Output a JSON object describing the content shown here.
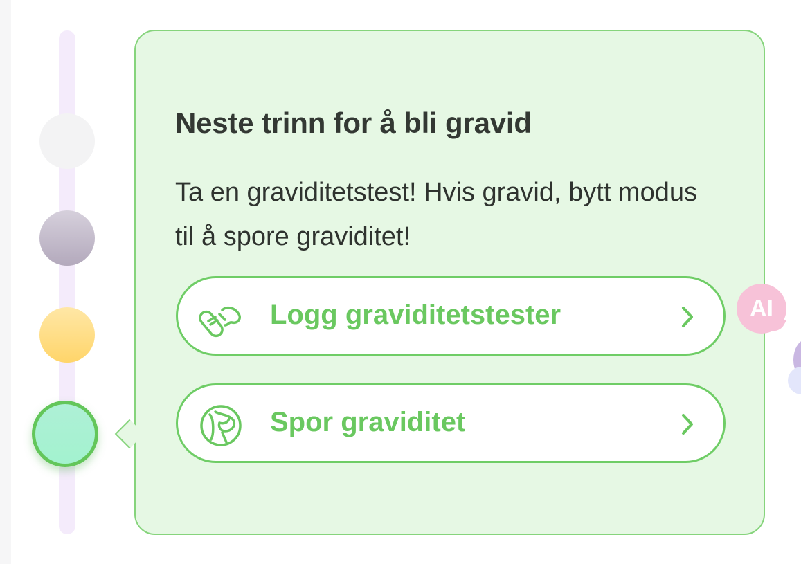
{
  "card": {
    "title": "Neste trinn for å bli gravid",
    "description": "Ta en graviditetstest! Hvis gravid, bytt modus til å spore graviditet!",
    "buttons": [
      {
        "label": "Logg graviditetstester",
        "icon": "pregnancy-test-icon"
      },
      {
        "label": "Spor graviditet",
        "icon": "pregnancy-belly-icon"
      }
    ]
  },
  "ai_badge": {
    "label": "AI"
  },
  "timeline": {
    "steps": [
      {
        "color": "#f3f3f4"
      },
      {
        "color": "#c4bccb"
      },
      {
        "color": "#ffdd80"
      },
      {
        "color": "#a8f1d3",
        "active": true
      }
    ]
  },
  "colors": {
    "accent": "#6ac860",
    "card_bg": "#e6f8e4",
    "ai_badge": "#f7c2d8"
  }
}
